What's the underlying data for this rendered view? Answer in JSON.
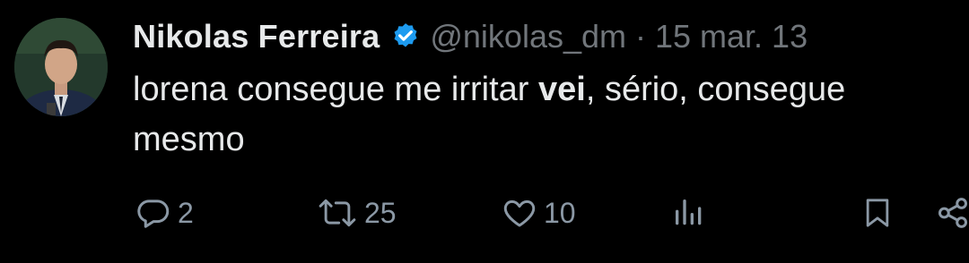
{
  "tweet": {
    "author_name": "Nikolas Ferreira",
    "handle": "@nikolas_dm",
    "separator": "·",
    "date": "15 mar. 13",
    "text_before": "lorena consegue me irritar ",
    "text_bold": "vei",
    "text_after": ", sério, consegue mesmo"
  },
  "actions": {
    "replies": "2",
    "retweets": "25",
    "likes": "10"
  },
  "icons": {
    "verified": "verified-badge-icon",
    "reply": "reply-icon",
    "retweet": "retweet-icon",
    "like": "heart-icon",
    "views": "views-icon",
    "bookmark": "bookmark-icon",
    "share": "share-icon"
  },
  "colors": {
    "background": "#000000",
    "text": "#e7e9ea",
    "secondary": "#71767b",
    "verified": "#1d9bf0"
  }
}
